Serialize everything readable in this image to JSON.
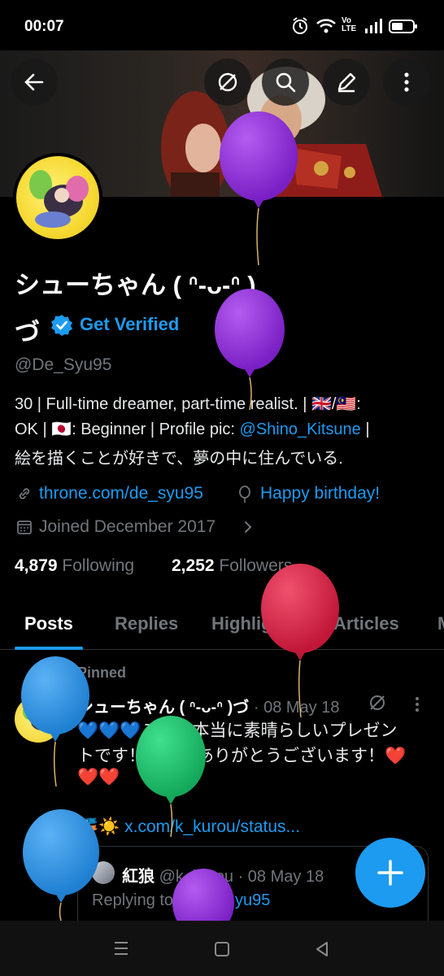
{
  "status_bar": {
    "time": "00:07",
    "icons": [
      "alarm-icon",
      "wifi-icon",
      "volte-icon",
      "signal-icon",
      "battery-icon"
    ],
    "volte_label": "Vo\nLTE"
  },
  "header": {
    "buttons": [
      "back-icon",
      "hide-icon",
      "search-icon",
      "edit-icon",
      "more-icon"
    ]
  },
  "profile": {
    "display_name": "シューちゃん ( ᐢ-ᴗ-ᐢ )",
    "display_name_cont": "づ",
    "get_verified": "Get Verified",
    "handle": "@De_Syu95",
    "bio": {
      "line1": "30 | Full-time dreamer, part-time realist. | 🇬🇧/🇲🇾:",
      "line2_a": "OK | 🇯🇵: Beginner | Profile pic: ",
      "line2_link": "@Shino_Kitsune",
      "line2_b": " |",
      "line3": "絵を描くことが好きで、夢の中に住んでいる."
    },
    "website": "throne.com/de_syu95",
    "birthday": "Happy birthday!",
    "joined": "Joined December 2017",
    "following_count": "4,879",
    "following_label": "Following",
    "followers_count": "2,252",
    "followers_label": "Followers"
  },
  "tabs": [
    "Posts",
    "Replies",
    "Highlights",
    "Articles",
    "M"
  ],
  "pinned_post": {
    "pinned_label": "Pinned",
    "author": "シューちゃん ( ᐢ-ᴗ-ᐢ )づ",
    "date": "· 08 May 18",
    "text_line1": "💙💙💙これは本当に素晴らしいプレゼン",
    "text_line2": "トです！本当にありがとうございます！❤️",
    "text_line3": "❤️❤️",
    "link_emoji": "🎏☀️",
    "link": "x.com/k_kurou/status...",
    "quote": {
      "author": "紅狼",
      "handle": "@k_kurou",
      "date": "· 08 May 18",
      "replying_to_label": "Replying to",
      "replying_to": "@De_Syu95"
    }
  },
  "colors": {
    "accent": "#1d9bf0",
    "muted": "#71767b",
    "balloon_purple": "#8b2bd6",
    "balloon_red": "#d8244a",
    "balloon_green": "#1fbf6a",
    "balloon_blue": "#2b8fe0"
  }
}
